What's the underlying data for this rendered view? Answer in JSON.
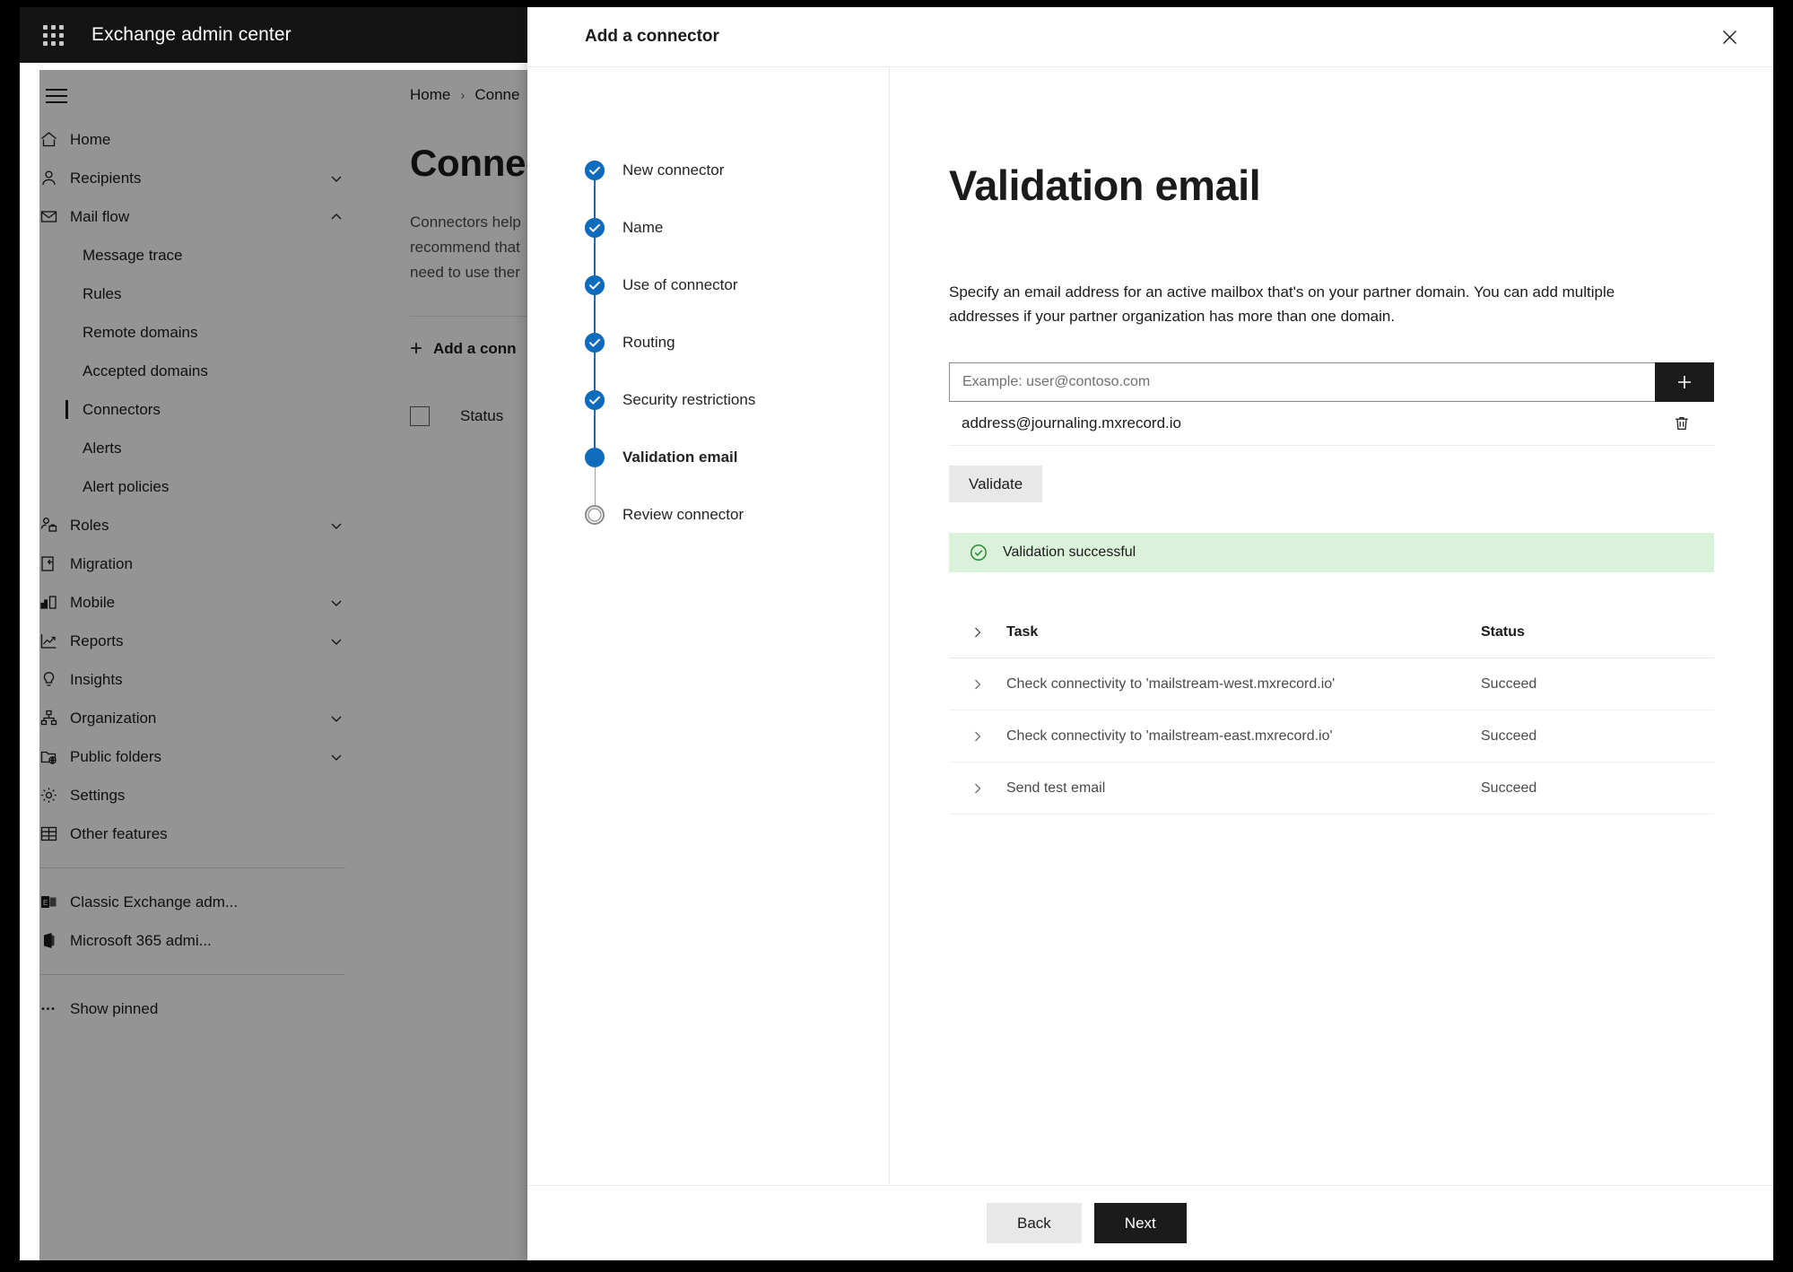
{
  "suite": {
    "title": "Exchange admin center",
    "waffle_icon": "app-launcher-icon",
    "hamburger_icon": "hamburger-icon"
  },
  "sidebar": {
    "items": [
      {
        "label": "Home",
        "icon": "home-icon",
        "level": "top",
        "chevron": ""
      },
      {
        "label": "Recipients",
        "icon": "person-icon",
        "level": "top",
        "chevron": "down"
      },
      {
        "label": "Mail flow",
        "icon": "mail-icon",
        "level": "top",
        "chevron": "up"
      },
      {
        "label": "Message trace",
        "icon": "",
        "level": "sub",
        "chevron": ""
      },
      {
        "label": "Rules",
        "icon": "",
        "level": "sub",
        "chevron": ""
      },
      {
        "label": "Remote domains",
        "icon": "",
        "level": "sub",
        "chevron": ""
      },
      {
        "label": "Accepted domains",
        "icon": "",
        "level": "sub",
        "chevron": ""
      },
      {
        "label": "Connectors",
        "icon": "",
        "level": "sub",
        "chevron": "",
        "selected": true
      },
      {
        "label": "Alerts",
        "icon": "",
        "level": "sub",
        "chevron": ""
      },
      {
        "label": "Alert policies",
        "icon": "",
        "level": "sub",
        "chevron": ""
      },
      {
        "label": "Roles",
        "icon": "roles-icon",
        "level": "top",
        "chevron": "down"
      },
      {
        "label": "Migration",
        "icon": "migration-icon",
        "level": "top",
        "chevron": ""
      },
      {
        "label": "Mobile",
        "icon": "mobile-icon",
        "level": "top",
        "chevron": "down"
      },
      {
        "label": "Reports",
        "icon": "reports-icon",
        "level": "top",
        "chevron": "down"
      },
      {
        "label": "Insights",
        "icon": "lightbulb-icon",
        "level": "top",
        "chevron": ""
      },
      {
        "label": "Organization",
        "icon": "organization-icon",
        "level": "top",
        "chevron": "down"
      },
      {
        "label": "Public folders",
        "icon": "public-folder-icon",
        "level": "top",
        "chevron": "down"
      },
      {
        "label": "Settings",
        "icon": "gear-icon",
        "level": "top",
        "chevron": ""
      },
      {
        "label": "Other features",
        "icon": "grid-table-icon",
        "level": "top",
        "chevron": ""
      }
    ],
    "external_items": [
      {
        "label": "Classic Exchange adm...",
        "icon": "classic-exchange-icon"
      },
      {
        "label": "Microsoft 365 admi...",
        "icon": "microsoft-365-icon"
      }
    ],
    "pinned": {
      "label": "Show pinned",
      "icon": "ellipsis-icon"
    }
  },
  "main": {
    "breadcrumb": {
      "home": "Home",
      "separator": "›",
      "current": "Conne"
    },
    "page_title": "Connect",
    "description_lines": [
      "Connectors help",
      "recommend that",
      "need to use ther"
    ],
    "command_bar": {
      "add_label": "Add a conn",
      "plus_icon": "plus-icon"
    },
    "table_header": {
      "checkbox_icon": "checkbox-icon",
      "status": "Status"
    }
  },
  "dialog": {
    "title": "Add a connector",
    "close_icon": "close-icon",
    "steps": [
      {
        "label": "New connector",
        "state": "done"
      },
      {
        "label": "Name",
        "state": "done"
      },
      {
        "label": "Use of connector",
        "state": "done"
      },
      {
        "label": "Routing",
        "state": "done"
      },
      {
        "label": "Security restrictions",
        "state": "done"
      },
      {
        "label": "Validation email",
        "state": "current"
      },
      {
        "label": "Review connector",
        "state": "todo"
      }
    ],
    "heading": "Validation email",
    "description": "Specify an email address for an active mailbox that's on your partner domain. You can add multiple addresses if your partner organization has more than one domain.",
    "email_input": {
      "value": "",
      "placeholder": "Example: user@contoso.com"
    },
    "add_button": {
      "label": "+",
      "icon": "plus-icon"
    },
    "addresses": [
      {
        "value": "address@journaling.mxrecord.io",
        "delete_icon": "trash-icon"
      }
    ],
    "validate_button": "Validate",
    "banner": {
      "text": "Validation successful",
      "icon": "check-circle-icon",
      "bg": "#d9f2d9",
      "fg": "#2e8b35"
    },
    "task_table": {
      "columns": {
        "task": "Task",
        "status": "Status"
      },
      "expand_icon": "chevron-right-icon",
      "rows": [
        {
          "task": "Check connectivity to 'mailstream-west.mxrecord.io'",
          "status": "Succeed"
        },
        {
          "task": "Check connectivity to 'mailstream-east.mxrecord.io'",
          "status": "Succeed"
        },
        {
          "task": "Send test email",
          "status": "Succeed"
        }
      ]
    },
    "footer": {
      "back": "Back",
      "next": "Next"
    }
  },
  "colors": {
    "accent": "#0f6cbd",
    "suite_bar": "#141414",
    "primary_button": "#1b1b1b",
    "success_bg": "#d9f2d9",
    "success_fg": "#2e8b35"
  }
}
